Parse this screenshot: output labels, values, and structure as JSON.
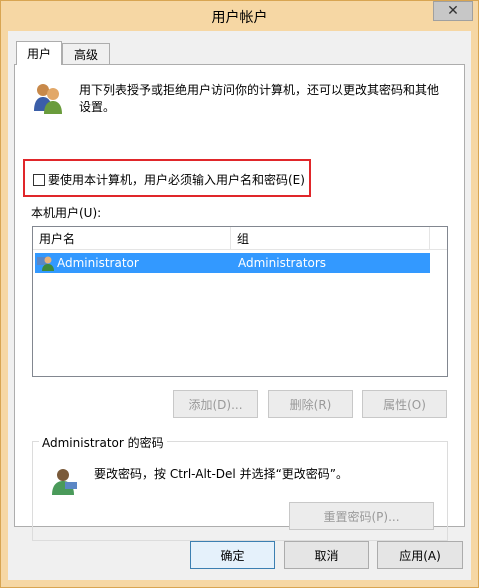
{
  "window": {
    "title": "用户帐户",
    "close_label": "✕"
  },
  "tabs": [
    {
      "label": "用户"
    },
    {
      "label": "高级"
    }
  ],
  "intro_text": "用下列表授予或拒绝用户访问你的计算机，还可以更改其密码和其他设置。",
  "require_password_checkbox": {
    "label": "要使用本计算机，用户必须输入用户名和密码(E)",
    "checked": false
  },
  "users_label": "本机用户(U):",
  "users_table": {
    "columns": [
      "用户名",
      "组"
    ],
    "rows": [
      {
        "name": "Administrator",
        "group": "Administrators",
        "selected": true
      }
    ]
  },
  "user_buttons": {
    "add": "添加(D)...",
    "remove": "删除(R)",
    "properties": "属性(O)"
  },
  "password_group": {
    "title": "Administrator 的密码",
    "text": "要改密码，按 Ctrl-Alt-Del 并选择“更改密码”。",
    "reset_button": "重置密码(P)..."
  },
  "dialog_buttons": {
    "ok": "确定",
    "cancel": "取消",
    "apply": "应用(A)"
  }
}
